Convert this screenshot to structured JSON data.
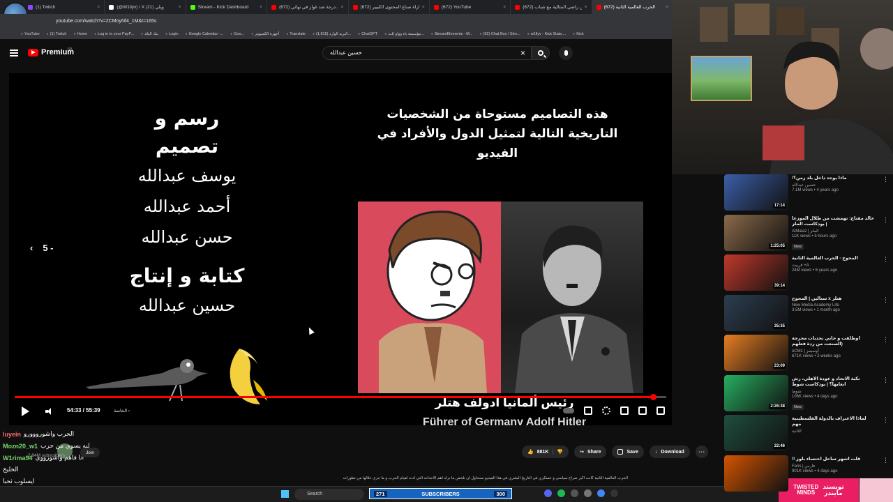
{
  "browser": {
    "tabs": [
      {
        "title": "(1) Twitch",
        "color": "#9146ff"
      },
      {
        "title": "(@W1llyv) / X (21) ويلي",
        "color": "#ffffff"
      },
      {
        "title": "Stream - Kick Dashboard",
        "color": "#53fc18"
      },
      {
        "title": "(672) درجة ضد غواز في نهائي...",
        "color": "#ff0000"
      },
      {
        "title": "(672) مباراة صناع المحتوى الكبيير...",
        "color": "#ff0000"
      },
      {
        "title": "(672) YouTube",
        "color": "#ff0000"
      },
      {
        "title": "(672) من راضي المثالية مع شباب...",
        "color": "#ff0000"
      },
      {
        "title": "(672) الحرب العالمية الثانية",
        "color": "#ff0000",
        "active": true
      }
    ],
    "profile_name": "W1llyv",
    "url": "youtube.com/watch?v=2CMoyNf4_1M&t=165s",
    "bookmarks": [
      "YouTube",
      "(1) Twitch",
      "Home",
      "Log in to your PayP...",
      "بنك البلاد",
      "Login",
      "Google Calendar -...",
      "Goo...",
      "أجهزة الكمبيوتر",
      "Translate",
      "البريد الوارد (1,815)...",
      "ChatGPT",
      "مؤسسة باء وواو للت...",
      "StreamElements - M...",
      "(52) Chat Box / Stre...",
      "w1llyv - Kick Stats,...",
      "Kick"
    ]
  },
  "youtube": {
    "logo_text": "Premium",
    "region": "SA",
    "search_value": "حسين عبدالله"
  },
  "video": {
    "credits_heading_1": "رسم و تصميم",
    "credits_names_1": [
      "يوسف عبدالله",
      "أحمد عبدالله",
      "حسن عبدالله"
    ],
    "credits_heading_2": "كتابة و إنتاج",
    "credits_names_2": [
      "حسين عبدالله"
    ],
    "notice_text": "هذه التصاميم مستوحاة من الشخصيات التاريخية التالية لتمثيل الدول والأفراد في الفيديو",
    "caption_ar": "رئيس ألمانيا ادولف هتلر",
    "caption_en": "Führer of Germany Adolf Hitler",
    "skip_label": "5 -",
    "current_time": "54:33",
    "duration": "55:39",
    "time_display": "54:33 / 55:39",
    "chapter_label": "الخاتمة",
    "progress": 0.98
  },
  "channel": {
    "name": "Mozn20_w1",
    "subscribers": "2.84M subscribers",
    "join_label": "Join",
    "likes": "881K",
    "share_label": "Share",
    "save_label": "Save",
    "download_label": "Download"
  },
  "chat_overlay": [
    {
      "user": "luyein",
      "text": "الحرب واشورووورو"
    },
    {
      "user": "Mozn20_w1",
      "text": "ليه يسوي من حرب"
    },
    {
      "user": "W1rima94",
      "text": "أنا فاهم واشورووي"
    },
    {
      "user": "",
      "text": "الخليج"
    },
    {
      "user": "",
      "text": "ايسلوب ثحبا"
    }
  ],
  "description_snippet": "الحرب العالمية الثانية كانت اكبر صراع سياسي و عسكري في التاريخ البشري في هذا الفيديو سنحاول ان نلخص ما نراه اهم الاحداث التي ادت لقيام الحرب و ما جرى خلالها من تطورات",
  "taskbar": {
    "search_label": "Search",
    "subs_current": "271",
    "subs_label": "SUBSCRIBERS",
    "subs_goal": "300",
    "brand_en_1": "TWISTED",
    "brand_en_2": "MINDS",
    "brand_ar_1": "تويستد",
    "brand_ar_2": "مايندز"
  },
  "recommended": [
    {
      "title": "ماذا يوجد داخل بلد زمن؟!",
      "channel": "حسين عبدالله",
      "meta": "7.1M views • 4 years ago",
      "duration": "17:14",
      "new": false,
      "color": "#3b5fa8"
    },
    {
      "title": "خالد مفتاح: تهمشت من طلال الموزعا | بودكاست الملز",
      "channel": "AlMalaz | الملز",
      "meta": "11K views • 5 hours ago",
      "duration": "1:25:05",
      "new": true,
      "color": "#8a6a4a"
    },
    {
      "title": "المحوج - الحرب العالمية الثانية",
      "channel": "قريبت +A",
      "meta": "24M views • 6 years ago",
      "duration": "39:14",
      "new": false,
      "color": "#c0392b"
    },
    {
      "title": "هتلر x ستالين | المحوج",
      "channel": "New Media Academy Life",
      "meta": "3.5M views • 1 month ago",
      "duration": "35:35",
      "new": false,
      "color": "#2c3e50"
    },
    {
      "title": "اوطلقت و جاني تحديات محرجة (السنعت من ردة فعلهم",
      "channel": "oCMz | أوسيمز",
      "meta": "671K views • 2 weeks ago",
      "duration": "23:09",
      "new": false,
      "color": "#e67e22"
    },
    {
      "title": "نكبة الاتحاد و عودة الأهلي، رش ابغايها؟ | بودكاست شوط",
      "channel": "شوط",
      "meta": "106K views • 4 days ago",
      "duration": "2:26:38",
      "new": true,
      "color": "#27ae60"
    },
    {
      "title": "لماذا الاعتراف بالدولة الفلسطينية مهم",
      "channel": "الثانية",
      "meta": "",
      "duration": "22:46",
      "new": false,
      "color": "#1f4e3d"
    },
    {
      "title": "قلت اشهر ساحل احتساء بلوز !!",
      "channel": "Faris | فارس",
      "meta": "901K views • 4 days ago",
      "duration": "",
      "new": false,
      "color": "#d35400"
    }
  ]
}
